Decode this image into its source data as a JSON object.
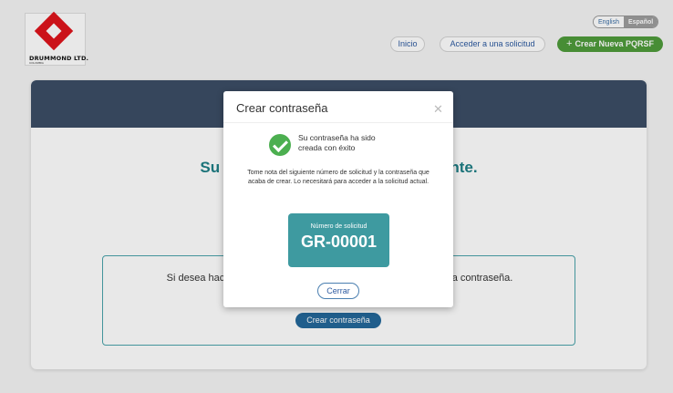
{
  "header": {
    "logo_text": "DRUMMOND LTD.",
    "logo_sub": "COLOMBIA",
    "lang_english": "English",
    "lang_espanol": "Español",
    "nav_inicio": "Inicio",
    "nav_acceder": "Acceder a una solicitud",
    "nav_crear_icon": "plus-icon",
    "nav_crear": "Crear Nueva PQRSF"
  },
  "card": {
    "title": "Su solicitud fue creada exitosamente.",
    "inner_text": "Si desea hacer un seguimiento de su solicitud, por favor cree una contraseña.",
    "create_password_label": "Crear contraseña"
  },
  "modal": {
    "title": "Crear contraseña",
    "close_icon": "close-icon",
    "success_icon": "check-circle-icon",
    "success_text": "Su contraseña ha sido creada con éxito",
    "note": "Tome nota del siguiente número de solicitud y la contraseña que acaba de crear. Lo necesitará para acceder a la solicitud actual.",
    "request_label": "Número de solicitud",
    "request_number": "GR-00001",
    "close_button": "Cerrar"
  },
  "colors": {
    "primary_green": "#4f9c3b",
    "header_navy": "#3c4d66",
    "teal": "#3e9aa0",
    "button_blue": "#24689a"
  }
}
